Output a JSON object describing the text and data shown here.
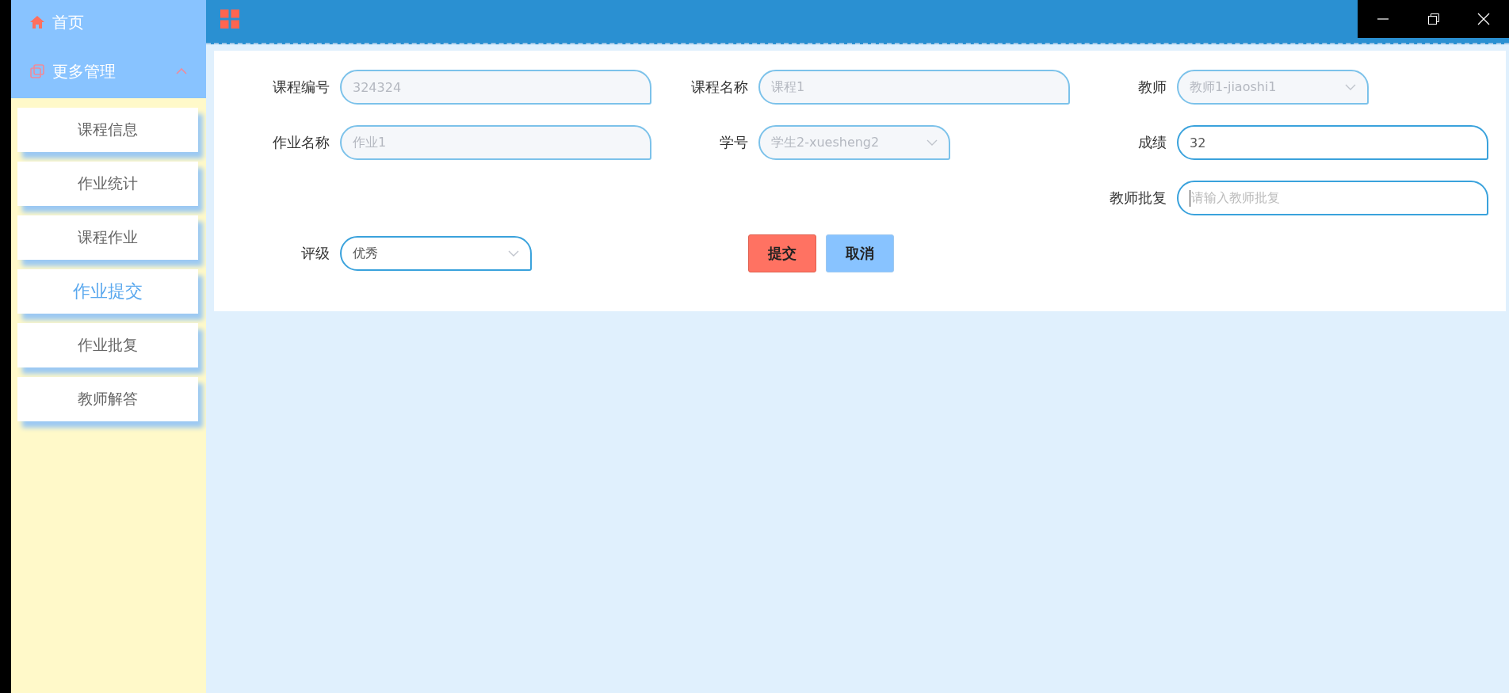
{
  "sidebar": {
    "home": {
      "label": "首页"
    },
    "group": {
      "label": "更多管理",
      "expanded": true,
      "items": [
        {
          "label": "课程信息",
          "selected": false
        },
        {
          "label": "作业统计",
          "selected": false
        },
        {
          "label": "课程作业",
          "selected": false
        },
        {
          "label": "作业提交",
          "selected": true
        },
        {
          "label": "作业批复",
          "selected": false
        },
        {
          "label": "教师解答",
          "selected": false
        }
      ]
    }
  },
  "form": {
    "fields": [
      {
        "label": "课程编号",
        "kind": "text",
        "value": "324324",
        "disabled": true
      },
      {
        "label": "课程名称",
        "kind": "text",
        "value": "课程1",
        "disabled": true
      },
      {
        "label": "教师",
        "kind": "select",
        "value": "教师1-jiaoshi1",
        "disabled": true
      },
      {
        "label": "作业名称",
        "kind": "text",
        "value": "作业1",
        "disabled": true
      },
      {
        "label": "学号",
        "kind": "select",
        "value": "学生2-xuesheng2",
        "disabled": true
      },
      {
        "label": "成绩",
        "kind": "text",
        "value": "32",
        "disabled": false
      },
      {
        "label": "教师批复",
        "kind": "text",
        "placeholder": "请输入教师批复",
        "disabled": false
      },
      {
        "label": "评级",
        "kind": "select",
        "value": "优秀",
        "disabled": false
      }
    ],
    "buttons": [
      {
        "label": "提交",
        "kind": "primary"
      },
      {
        "label": "取消",
        "kind": "secondary"
      }
    ]
  }
}
